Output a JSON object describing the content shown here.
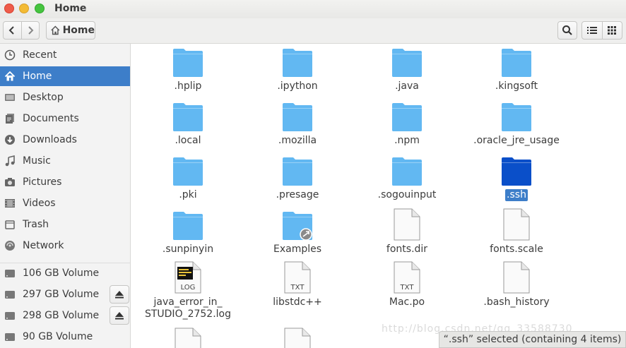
{
  "window": {
    "title": "Home"
  },
  "toolbar": {
    "path_label": "Home",
    "icons": [
      "back-icon",
      "forward-icon",
      "home-icon",
      "search-icon",
      "list-view-icon",
      "grid-view-icon"
    ]
  },
  "sidebar": {
    "places": [
      {
        "label": "Recent",
        "icon": "clock-icon"
      },
      {
        "label": "Home",
        "icon": "home-icon",
        "active": true
      },
      {
        "label": "Desktop",
        "icon": "desktop-icon"
      },
      {
        "label": "Documents",
        "icon": "documents-icon"
      },
      {
        "label": "Downloads",
        "icon": "download-icon"
      },
      {
        "label": "Music",
        "icon": "music-icon"
      },
      {
        "label": "Pictures",
        "icon": "camera-icon"
      },
      {
        "label": "Videos",
        "icon": "video-icon"
      },
      {
        "label": "Trash",
        "icon": "trash-icon"
      },
      {
        "label": "Network",
        "icon": "network-icon"
      }
    ],
    "devices": [
      {
        "label": "106 GB Volume",
        "icon": "drive-icon",
        "eject": false
      },
      {
        "label": "297 GB Volume",
        "icon": "drive-icon",
        "eject": true
      },
      {
        "label": "298 GB Volume",
        "icon": "drive-icon",
        "eject": true
      },
      {
        "label": "90 GB Volume",
        "icon": "drive-icon",
        "eject": false
      }
    ]
  },
  "files": [
    {
      "name": ".hplip",
      "type": "folder"
    },
    {
      "name": ".ipython",
      "type": "folder"
    },
    {
      "name": ".java",
      "type": "folder"
    },
    {
      "name": ".kingsoft",
      "type": "folder"
    },
    {
      "name": ".local",
      "type": "folder"
    },
    {
      "name": ".mozilla",
      "type": "folder"
    },
    {
      "name": ".npm",
      "type": "folder"
    },
    {
      "name": ".oracle_jre_usage",
      "type": "folder"
    },
    {
      "name": ".pki",
      "type": "folder"
    },
    {
      "name": ".presage",
      "type": "folder"
    },
    {
      "name": ".sogouinput",
      "type": "folder"
    },
    {
      "name": ".ssh",
      "type": "folder",
      "selected": true
    },
    {
      "name": ".sunpinyin",
      "type": "folder"
    },
    {
      "name": "Examples",
      "type": "folder-link"
    },
    {
      "name": "fonts.dir",
      "type": "file"
    },
    {
      "name": "fonts.scale",
      "type": "file"
    },
    {
      "name": "java_error_in_\nSTUDIO_2752.log",
      "type": "log",
      "badge": "LOG"
    },
    {
      "name": "libstdc++",
      "type": "text",
      "badge": "TXT"
    },
    {
      "name": "Mac.po",
      "type": "text",
      "badge": "TXT"
    },
    {
      "name": ".bash_history",
      "type": "file"
    }
  ],
  "status": {
    "text": "“.ssh” selected  (containing 4 items)"
  },
  "watermark": "http://blog.csdn.net/qq_33588730",
  "colors": {
    "accent": "#3d7ec9",
    "folder": "#62b8f2",
    "folder_selected": "#0a4fc9"
  }
}
